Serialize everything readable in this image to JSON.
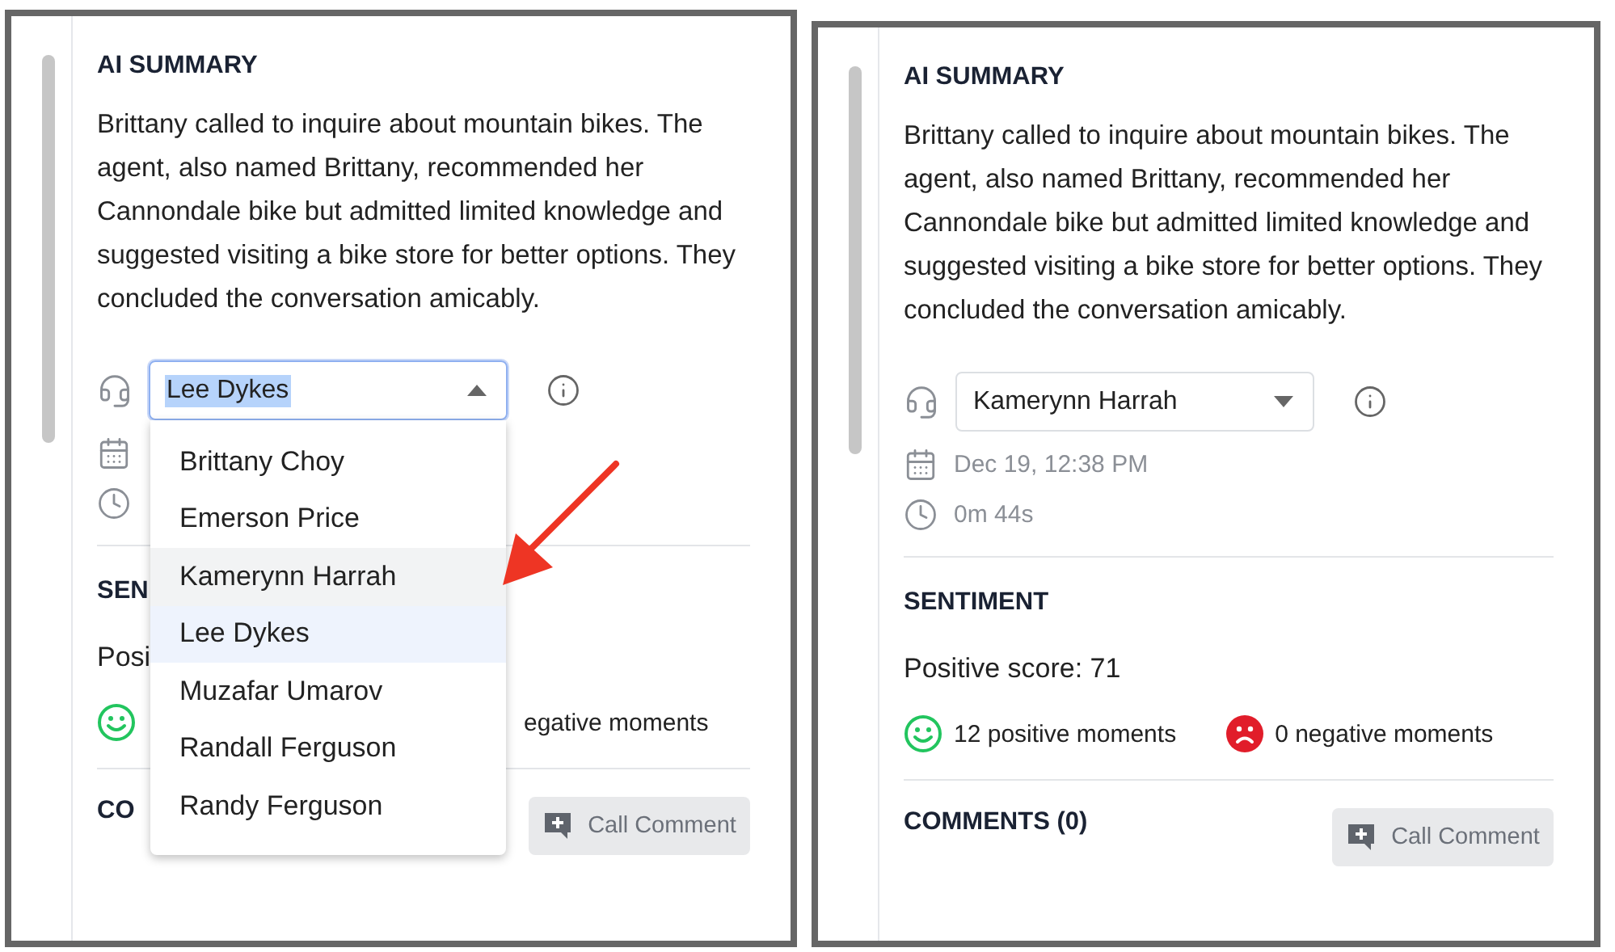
{
  "panels": [
    {
      "heading": "AI SUMMARY",
      "summary": "Brittany called to inquire about mountain bikes. The agent, also named Brittany, recommended her Cannondale bike but admitted limited knowledge and suggested visiting a bike store for better options. They concluded the conversation amicably.",
      "agent_select": {
        "value": "Lee Dykes",
        "expanded": true,
        "options": [
          {
            "label": "Brittany Choy",
            "selected": false,
            "hovered": false
          },
          {
            "label": "Emerson Price",
            "selected": false,
            "hovered": false
          },
          {
            "label": "Kamerynn Harrah",
            "selected": false,
            "hovered": true
          },
          {
            "label": "Lee Dykes",
            "selected": true,
            "hovered": false
          },
          {
            "label": "Muzafar Umarov",
            "selected": false,
            "hovered": false
          },
          {
            "label": "Randall Ferguson",
            "selected": false,
            "hovered": false
          },
          {
            "label": "Randy Ferguson",
            "selected": false,
            "hovered": false
          }
        ]
      },
      "meta": [
        {
          "kind": "date"
        },
        {
          "kind": "duration"
        }
      ],
      "sentiment_heading": "SEN",
      "score": "Posi",
      "moments": [
        {
          "kind": "positive"
        },
        {
          "kind": "plain",
          "text": "egative moments"
        }
      ],
      "comments_heading": "CO",
      "comment_button": "Call Comment"
    },
    {
      "heading": "AI SUMMARY",
      "summary": "Brittany called to inquire about mountain bikes. The agent, also named Brittany, recommended her Cannondale bike but admitted limited knowledge and suggested visiting a bike store for better options. They concluded the conversation amicably.",
      "agent_select": {
        "value": "Kamerynn Harrah",
        "expanded": false
      },
      "meta": [
        {
          "kind": "date",
          "text": "Dec 19, 12:38 PM"
        },
        {
          "kind": "duration",
          "text": "0m 44s"
        }
      ],
      "sentiment_heading": "SENTIMENT",
      "score": "Positive score: 71",
      "moments": [
        {
          "kind": "positive",
          "text": "12 positive moments"
        },
        {
          "kind": "negative",
          "text": "0 negative moments"
        }
      ],
      "comments_heading": "COMMENTS (0)",
      "comment_button": "Call Comment"
    }
  ]
}
